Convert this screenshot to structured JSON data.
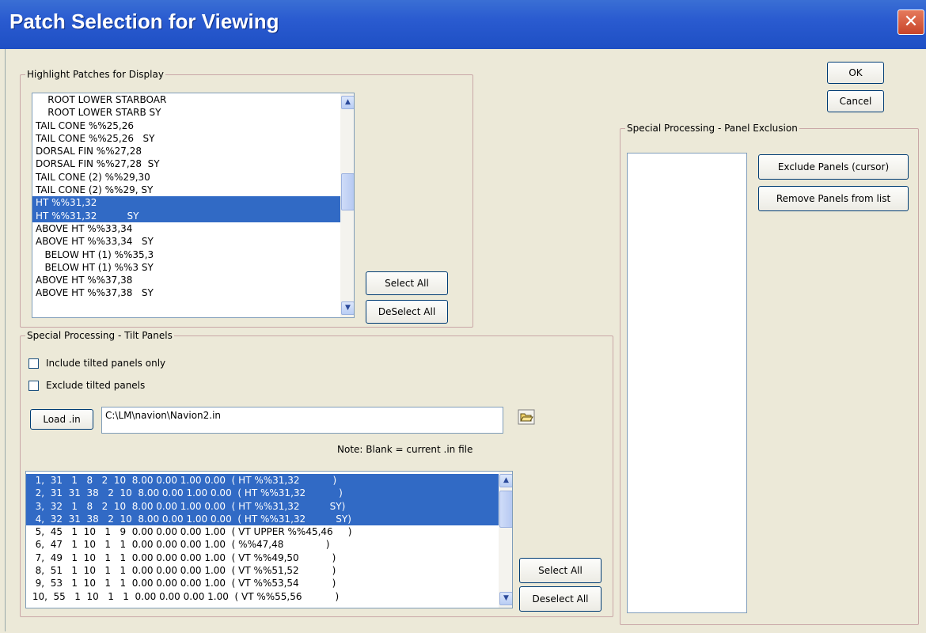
{
  "window": {
    "title": "Patch Selection for Viewing",
    "close_symbol": "✕"
  },
  "buttons": {
    "ok": "OK",
    "cancel": "Cancel"
  },
  "highlight": {
    "label": "Highlight Patches for Display",
    "items": [
      {
        "text": "    ROOT LOWER STARBOAR",
        "selected": false
      },
      {
        "text": "    ROOT LOWER STARB SY",
        "selected": false
      },
      {
        "text": "TAIL CONE %%25,26",
        "selected": false
      },
      {
        "text": "TAIL CONE %%25,26   SY",
        "selected": false
      },
      {
        "text": "DORSAL FIN %%27,28",
        "selected": false
      },
      {
        "text": "DORSAL FIN %%27,28  SY",
        "selected": false
      },
      {
        "text": "TAIL CONE (2) %%29,30",
        "selected": false
      },
      {
        "text": "TAIL CONE (2) %%29, SY",
        "selected": false
      },
      {
        "text": "HT %%31,32",
        "selected": true
      },
      {
        "text": "HT %%31,32          SY",
        "selected": true
      },
      {
        "text": "ABOVE HT %%33,34",
        "selected": false
      },
      {
        "text": "ABOVE HT %%33,34   SY",
        "selected": false
      },
      {
        "text": "   BELOW HT (1) %%35,3",
        "selected": false
      },
      {
        "text": "   BELOW HT (1) %%3 SY",
        "selected": false
      },
      {
        "text": "ABOVE HT %%37,38",
        "selected": false
      },
      {
        "text": "ABOVE HT %%37,38   SY",
        "selected": false
      }
    ],
    "select_all": "Select All",
    "deselect_all": "DeSelect All"
  },
  "tilt": {
    "label": "Special Processing - Tilt Panels",
    "include_only": "Include tilted panels only",
    "exclude": "Exclude tilted panels",
    "load_button": "Load .in",
    "path": "C:\\LM\\navion\\Navion2.in",
    "note": "Note: Blank = current .in file",
    "rows": [
      {
        "text": "  1,  31   1   8   2  10  8.00 0.00 1.00 0.00  ( HT %%31,32           )",
        "selected": true
      },
      {
        "text": "  2,  31  31  38   2  10  8.00 0.00 1.00 0.00  ( HT %%31,32           )",
        "selected": true
      },
      {
        "text": "  3,  32   1   8   2  10  8.00 0.00 1.00 0.00  ( HT %%31,32          SY)",
        "selected": true
      },
      {
        "text": "  4,  32  31  38   2  10  8.00 0.00 1.00 0.00  ( HT %%31,32          SY)",
        "selected": true
      },
      {
        "text": "  5,  45   1  10   1   9  0.00 0.00 0.00 1.00  ( VT UPPER %%45,46     )",
        "selected": false
      },
      {
        "text": "  6,  47   1  10   1   1  0.00 0.00 0.00 1.00  ( %%47,48              )",
        "selected": false
      },
      {
        "text": "  7,  49   1  10   1   1  0.00 0.00 0.00 1.00  ( VT %%49,50           )",
        "selected": false
      },
      {
        "text": "  8,  51   1  10   1   1  0.00 0.00 0.00 1.00  ( VT %%51,52           )",
        "selected": false
      },
      {
        "text": "  9,  53   1  10   1   1  0.00 0.00 0.00 1.00  ( VT %%53,54           )",
        "selected": false
      },
      {
        "text": " 10,  55   1  10   1   1  0.00 0.00 0.00 1.00  ( VT %%55,56           )",
        "selected": false
      }
    ],
    "select_all": "Select All",
    "deselect_all": "Deselect All"
  },
  "exclusion": {
    "label": "Special Processing - Panel Exclusion",
    "exclude_button": "Exclude Panels (cursor)",
    "remove_button": "Remove Panels from list"
  },
  "icons": {
    "scroll_up": "▲",
    "scroll_down": "▼",
    "folder": "folder-open-icon"
  },
  "colors": {
    "titlebar": "#2a5bd0",
    "selection": "#316ac5",
    "face": "#ece9d8"
  }
}
